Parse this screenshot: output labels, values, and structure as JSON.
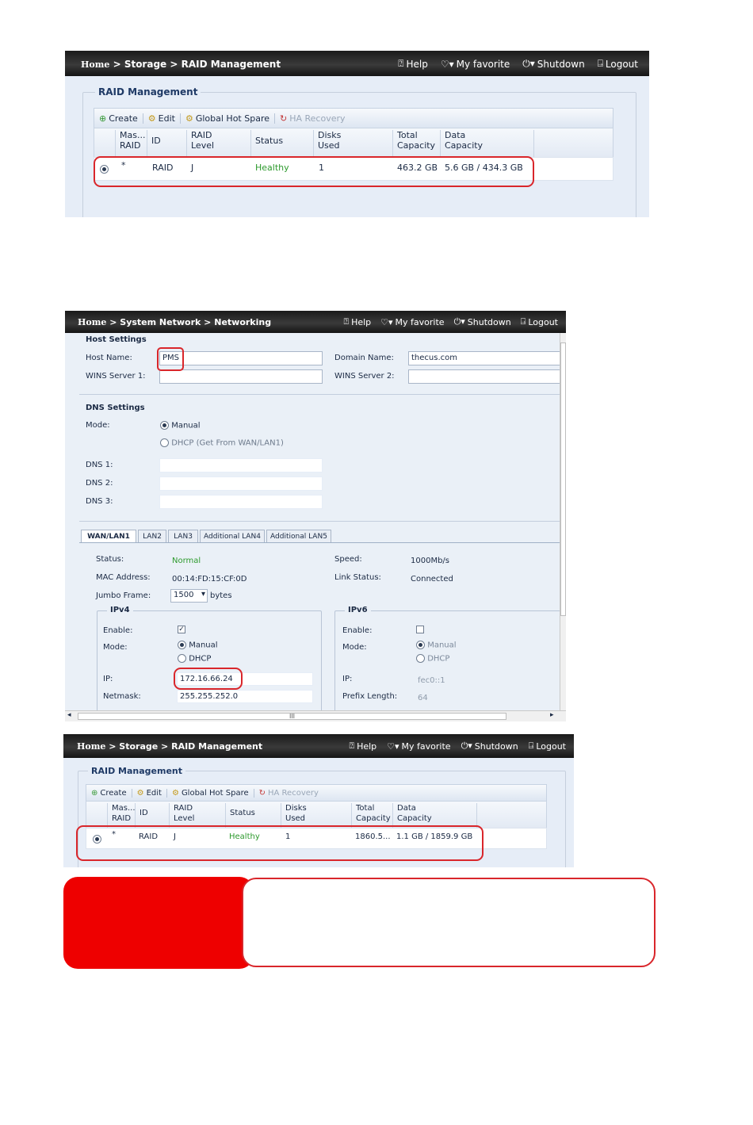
{
  "topbar": {
    "home": "Home",
    "sep": ">",
    "help": "Help",
    "favorite": "My favorite",
    "shutdown": "Shutdown",
    "logout": "Logout"
  },
  "raid1": {
    "breadcrumb_section": "Storage",
    "breadcrumb_page": "RAID Management",
    "legend": "RAID Management",
    "toolbar": {
      "create": "Create",
      "edit": "Edit",
      "global_hot_spare": "Global Hot Spare",
      "ha_recovery": "HA Recovery"
    },
    "columns": {
      "master_raid_1": "Mas...",
      "master_raid_2": "RAID",
      "id": "ID",
      "raid_level_1": "RAID",
      "raid_level_2": "Level",
      "status": "Status",
      "disks_1": "Disks",
      "disks_2": "Used",
      "total_1": "Total",
      "total_2": "Capacity",
      "data_1": "Data",
      "data_2": "Capacity"
    },
    "row": {
      "master": "*",
      "id": "RAID",
      "level": "J",
      "status": "Healthy",
      "disks": "1",
      "total": "463.2 GB",
      "data": "5.6 GB / 434.3 GB"
    }
  },
  "network": {
    "breadcrumb_section": "System Network",
    "breadcrumb_page": "Networking",
    "host_settings": "Host Settings",
    "host_name_label": "Host Name:",
    "host_name_value": "PMS",
    "domain_name_label": "Domain Name:",
    "domain_name_value": "thecus.com",
    "wins1_label": "WINS Server 1:",
    "wins2_label": "WINS Server 2:",
    "dns_settings": "DNS Settings",
    "mode_label": "Mode:",
    "mode_manual": "Manual",
    "mode_dhcp": "DHCP (Get From WAN/LAN1)",
    "dns1": "DNS 1:",
    "dns2": "DNS 2:",
    "dns3": "DNS 3:",
    "tabs": [
      "WAN/LAN1",
      "LAN2",
      "LAN3",
      "Additional LAN4",
      "Additional LAN5"
    ],
    "status_label": "Status:",
    "status_value": "Normal",
    "speed_label": "Speed:",
    "speed_value": "1000Mb/s",
    "mac_label": "MAC Address:",
    "mac_value": "00:14:FD:15:CF:0D",
    "link_label": "Link Status:",
    "link_value": "Connected",
    "jumbo_label": "Jumbo Frame:",
    "jumbo_value": "1500",
    "jumbo_unit": "bytes",
    "ipv4": "IPv4",
    "ipv6": "IPv6",
    "enable_label": "Enable:",
    "mode2_label": "Mode:",
    "manual": "Manual",
    "dhcp": "DHCP",
    "ip_label": "IP:",
    "ip_value": "172.16.66.24",
    "netmask_label": "Netmask:",
    "netmask_value": "255.255.252.0",
    "ipv6_ip_value": "fec0::1",
    "prefix_label": "Prefix Length:",
    "prefix_value": "64",
    "hscroll_thumb": "III"
  },
  "raid2": {
    "breadcrumb_section": "Storage",
    "breadcrumb_page": "RAID Management",
    "legend": "RAID Management",
    "toolbar": {
      "create": "Create",
      "edit": "Edit",
      "global_hot_spare": "Global Hot Spare",
      "ha_recovery": "HA Recovery"
    },
    "columns": {
      "master_raid_1": "Mas...",
      "master_raid_2": "RAID",
      "id": "ID",
      "raid_level_1": "RAID",
      "raid_level_2": "Level",
      "status": "Status",
      "disks_1": "Disks",
      "disks_2": "Used",
      "total_1": "Total",
      "total_2": "Capacity",
      "data_1": "Data",
      "data_2": "Capacity"
    },
    "row": {
      "master": "*",
      "id": "RAID",
      "level": "J",
      "status": "Healthy",
      "disks": "1",
      "total": "1860.5...",
      "data": "1.1 GB / 1859.9 GB"
    }
  },
  "colors": {
    "highlight_red": "#d9262b",
    "note_red": "#ee0000",
    "healthy_green": "#2d9a2d"
  }
}
